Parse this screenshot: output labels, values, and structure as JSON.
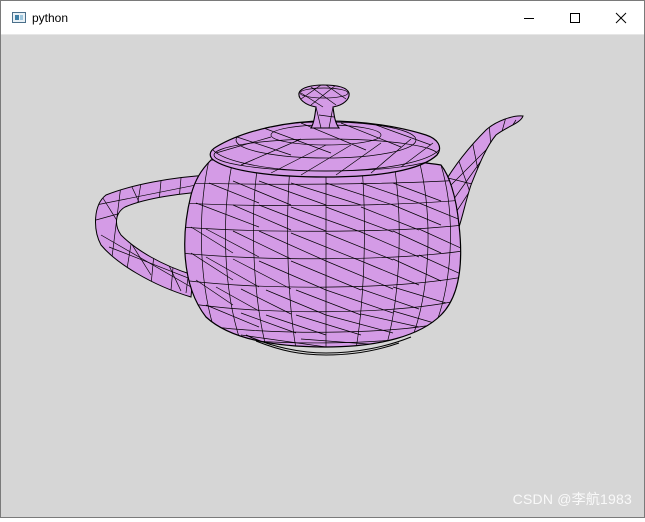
{
  "window": {
    "title": "python",
    "controls": [
      "minimize-icon",
      "maximize-icon",
      "close-icon"
    ]
  },
  "scene": {
    "object": "teapot-icon",
    "background_color": "#d6d6d6",
    "fill_color": "#d49be6",
    "edge_color": "#000000"
  },
  "watermark": "CSDN @李航1983"
}
